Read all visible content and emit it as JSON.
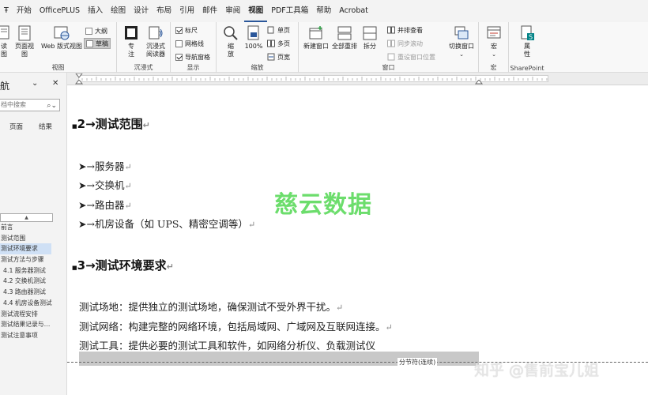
{
  "menubar": {
    "items": [
      {
        "label": "Ŧ"
      },
      {
        "label": "开始"
      },
      {
        "label": "OfficePLUS"
      },
      {
        "label": "插入"
      },
      {
        "label": "绘图"
      },
      {
        "label": "设计"
      },
      {
        "label": "布局"
      },
      {
        "label": "引用"
      },
      {
        "label": "邮件"
      },
      {
        "label": "审阅"
      },
      {
        "label": "视图"
      },
      {
        "label": "PDF工具箱"
      },
      {
        "label": "帮助"
      },
      {
        "label": "Acrobat"
      }
    ],
    "active_index": 10
  },
  "ribbon": {
    "views": {
      "group_label": "视图",
      "read_mode": "读\n图",
      "print_layout": "页面视图",
      "web_layout": "Web 版式视图",
      "outline": "大纲",
      "draft": "草稿"
    },
    "immersive": {
      "group_label": "沉浸式",
      "focus": "专\n注",
      "immersive_reader": "沉浸式\n阅读器"
    },
    "show": {
      "group_label": "显示",
      "ruler": "标尺",
      "gridlines": "网格线",
      "nav_pane": "导航窗格"
    },
    "zoom": {
      "group_label": "缩放",
      "zoom": "缩\n放",
      "hundred": "100%",
      "one_page": "单页",
      "multi_page": "多页",
      "page_width": "页宽"
    },
    "window": {
      "group_label": "窗口",
      "new_window": "新建窗口",
      "arrange_all": "全部重排",
      "split": "拆分",
      "side_by_side": "并排查看",
      "sync_scroll": "同步滚动",
      "reset_position": "重设窗口位置",
      "switch_window": "切换窗口"
    },
    "macros": {
      "group_label": "宏",
      "macros": "宏"
    },
    "sharepoint": {
      "group_label": "SharePoint",
      "properties": "属\n性"
    }
  },
  "nav": {
    "title": "航",
    "search_placeholder": "档中搜索",
    "tabs": [
      "页面",
      "结果"
    ],
    "collapse": "▲",
    "entries": [
      {
        "label": "前言",
        "sub": false,
        "selected": false
      },
      {
        "label": "测试范围",
        "sub": false,
        "selected": false
      },
      {
        "label": "测试环境要求",
        "sub": false,
        "selected": true
      },
      {
        "label": "测试方法与步骤",
        "sub": false,
        "selected": false
      },
      {
        "label": "4.1 服务器测试",
        "sub": true,
        "selected": false
      },
      {
        "label": "4.2 交换机测试",
        "sub": true,
        "selected": false
      },
      {
        "label": "4.3 路由器测试",
        "sub": true,
        "selected": false
      },
      {
        "label": "4.4 机房设备测试",
        "sub": true,
        "selected": false
      },
      {
        "label": "测试流程安排",
        "sub": false,
        "selected": false
      },
      {
        "label": "测试结果记录与…",
        "sub": false,
        "selected": false
      },
      {
        "label": "测试注意事项",
        "sub": false,
        "selected": false
      }
    ]
  },
  "document": {
    "heading2": {
      "num": "2",
      "arrow": "→",
      "text": "测试范围",
      "mark": "↵"
    },
    "bullets": [
      {
        "text": "服务器",
        "mark": "↵"
      },
      {
        "text": "交换机",
        "mark": "↵"
      },
      {
        "text": "路由器",
        "mark": "↵"
      },
      {
        "text": "机房设备（如 UPS、精密空调等）",
        "mark": "↵"
      }
    ],
    "heading3": {
      "num": "3",
      "arrow": "→",
      "text": "测试环境要求",
      "mark": "↵"
    },
    "paragraphs": [
      {
        "text": "测试场地：提供独立的测试场地，确保测试不受外界干扰。",
        "mark": "↵"
      },
      {
        "text": "测试网络：构建完整的网络环境，包括局域网、广域网及互联网连接。",
        "mark": "↵"
      },
      {
        "text": "测试工具：提供必要的测试工具和软件，如网络分析仪、负载测试仪",
        "mark": ""
      }
    ],
    "section_break": "分节符(连续)",
    "watermark": "慈云数据",
    "zhihu_watermark": "知乎 @售前宝儿姐"
  }
}
